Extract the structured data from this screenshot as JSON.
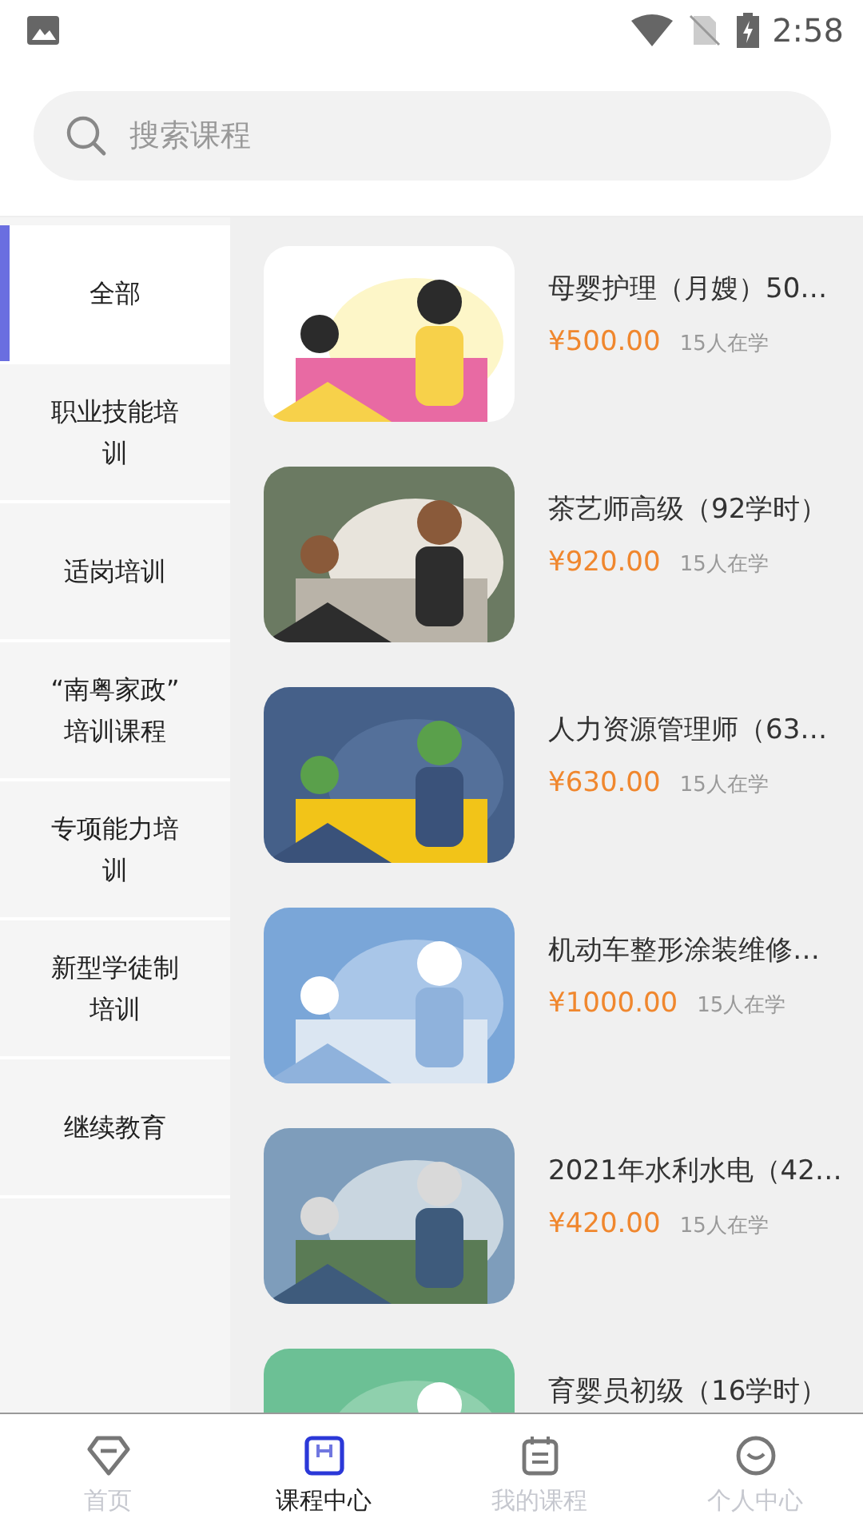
{
  "status_bar": {
    "time": "2:58"
  },
  "search": {
    "placeholder": "搜索课程"
  },
  "categories": [
    {
      "label": "全部",
      "selected": true
    },
    {
      "label": "职业技能培训",
      "selected": false
    },
    {
      "label": "适岗培训",
      "selected": false
    },
    {
      "label": "“南粤家政”培训课程",
      "selected": false
    },
    {
      "label": "专项能力培训",
      "selected": false
    },
    {
      "label": "新型学徒制培训",
      "selected": false
    },
    {
      "label": "继续教育",
      "selected": false
    }
  ],
  "courses": [
    {
      "title": "母婴护理（月嫂）50…",
      "price": "¥500.00",
      "learners": "15人在学"
    },
    {
      "title": "茶艺师高级（92学时）",
      "price": "¥920.00",
      "learners": "15人在学"
    },
    {
      "title": "人力资源管理师（63…",
      "price": "¥630.00",
      "learners": "15人在学"
    },
    {
      "title": "机动车整形涂装维修…",
      "price": "¥1000.00",
      "learners": "15人在学"
    },
    {
      "title": "2021年水利水电（42…",
      "price": "¥420.00",
      "learners": "15人在学"
    },
    {
      "title": "育婴员初级（16学时）"
    }
  ],
  "bottom_nav": [
    {
      "label": "首页",
      "kind": "home",
      "selected": false
    },
    {
      "label": "课程中心",
      "kind": "course",
      "selected": true
    },
    {
      "label": "我的课程",
      "kind": "mine",
      "selected": false
    },
    {
      "label": "个人中心",
      "kind": "profile",
      "selected": false
    }
  ]
}
